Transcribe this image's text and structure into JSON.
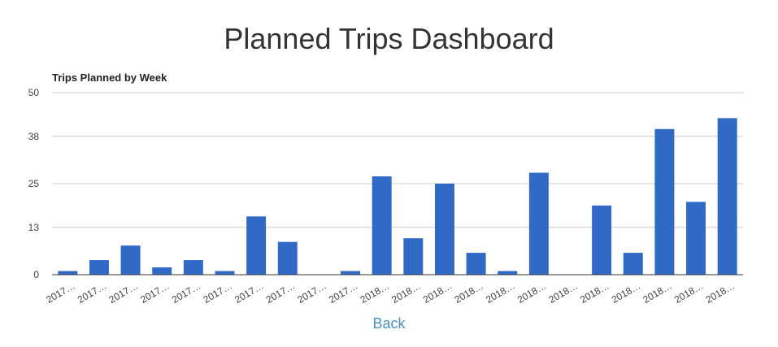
{
  "page": {
    "title": "Planned Trips Dashboard",
    "back_label": "Back"
  },
  "colors": {
    "bar": "#3169c6",
    "grid": "#cccccc",
    "axis_text": "#444444",
    "title_text": "#222222"
  },
  "chart_data": {
    "type": "bar",
    "title": "Trips Planned by Week",
    "xlabel": "",
    "ylabel": "",
    "ylim": [
      0,
      50
    ],
    "yticks": [
      "0",
      "13",
      "25",
      "38",
      "50"
    ],
    "grid": true,
    "legend": "none",
    "categories": [
      "2017…",
      "2017…",
      "2017…",
      "2017…",
      "2017…",
      "2017…",
      "2017…",
      "2017…",
      "2017…",
      "2017…",
      "2018…",
      "2018…",
      "2018…",
      "2018…",
      "2018…",
      "2018…",
      "2018…",
      "2018…",
      "2018…",
      "2018…",
      "2018…",
      "2018…"
    ],
    "values": [
      1,
      4,
      8,
      2,
      4,
      1,
      16,
      9,
      0,
      1,
      27,
      10,
      25,
      6,
      1,
      28,
      0,
      19,
      6,
      40,
      20,
      43
    ]
  }
}
